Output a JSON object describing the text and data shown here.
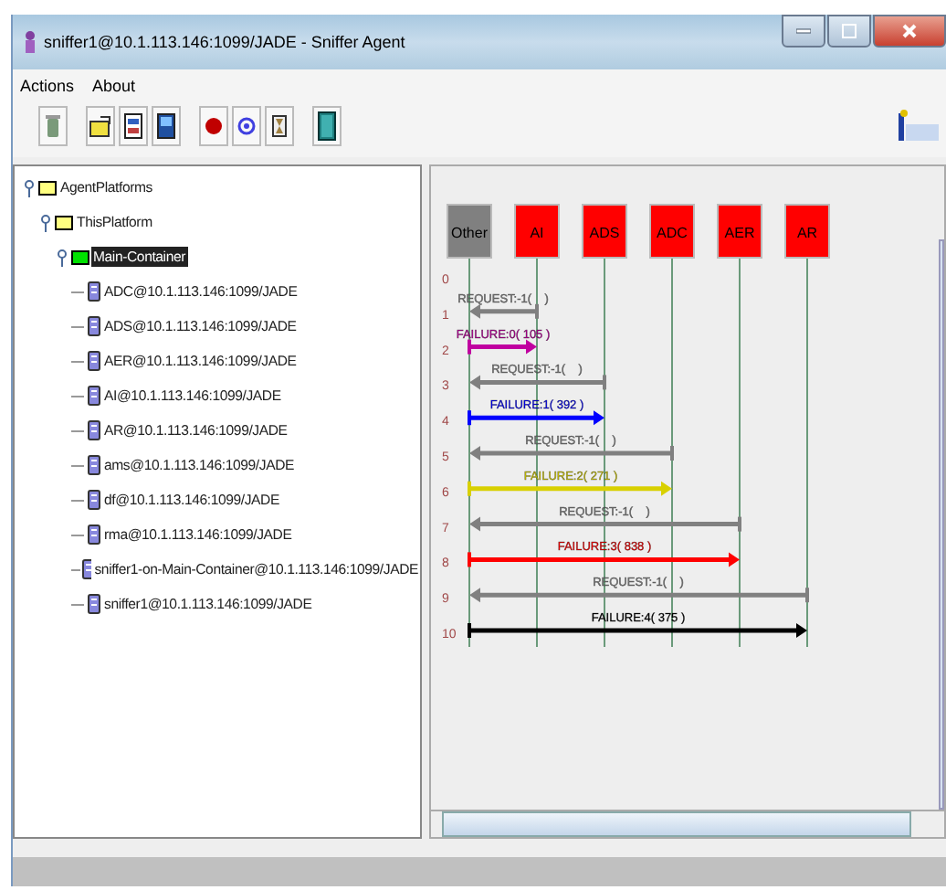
{
  "window": {
    "title": "sniffer1@10.1.113.146:1099/JADE - Sniffer Agent"
  },
  "menu": [
    {
      "label": "Actions"
    },
    {
      "label": "About"
    }
  ],
  "tree": [
    {
      "label": "AgentPlatforms",
      "kind": "folder",
      "expanded": true,
      "selected": false,
      "children": [
        {
          "label": "ThisPlatform",
          "kind": "folder",
          "expanded": true,
          "selected": false,
          "children": [
            {
              "label": "Main-Container",
              "kind": "container",
              "expanded": true,
              "selected": true,
              "children": [
                {
                  "label": "ADC@10.1.113.146:1099/JADE",
                  "kind": "agent",
                  "selected": false
                },
                {
                  "label": "ADS@10.1.113.146:1099/JADE",
                  "kind": "agent",
                  "selected": false
                },
                {
                  "label": "AER@10.1.113.146:1099/JADE",
                  "kind": "agent",
                  "selected": false
                },
                {
                  "label": "AI@10.1.113.146:1099/JADE",
                  "kind": "agent",
                  "selected": false
                },
                {
                  "label": "AR@10.1.113.146:1099/JADE",
                  "kind": "agent",
                  "selected": false
                },
                {
                  "label": "ams@10.1.113.146:1099/JADE",
                  "kind": "agent",
                  "selected": false
                },
                {
                  "label": "df@10.1.113.146:1099/JADE",
                  "kind": "agent",
                  "selected": false
                },
                {
                  "label": "rma@10.1.113.146:1099/JADE",
                  "kind": "agent",
                  "selected": false
                },
                {
                  "label": "sniffer1-on-Main-Container@10.1.113.146:1099/JADE",
                  "kind": "agent",
                  "selected": false
                },
                {
                  "label": "sniffer1@10.1.113.146:1099/JADE",
                  "kind": "agent",
                  "selected": false
                }
              ]
            }
          ]
        }
      ]
    }
  ],
  "sniffer": {
    "agents": [
      {
        "name": "Other",
        "color": "#808080"
      },
      {
        "name": "AI",
        "color": "#ff0000"
      },
      {
        "name": "ADS",
        "color": "#ff0000"
      },
      {
        "name": "ADC",
        "color": "#ff0000"
      },
      {
        "name": "AER",
        "color": "#ff0000"
      },
      {
        "name": "AR",
        "color": "#ff0000"
      }
    ],
    "rows": [
      "0",
      "1",
      "2",
      "3",
      "4",
      "5",
      "6",
      "7",
      "8",
      "9",
      "10"
    ],
    "messages": [
      {
        "kind": "incoming",
        "label": "REQUEST:-1(    )",
        "color": "#808080"
      },
      {
        "kind": "outgoing",
        "label": "FAILURE:0( 105 )",
        "color": "#c000a0"
      },
      {
        "kind": "incoming",
        "label": "REQUEST:-1(    )",
        "color": "#808080"
      },
      {
        "kind": "outgoing",
        "label": "FAILURE:1( 392 )",
        "color": "#0000ff"
      },
      {
        "kind": "incoming",
        "label": "REQUEST:-1(    )",
        "color": "#808080"
      },
      {
        "kind": "outgoing",
        "label": "FAILURE:2( 271 )",
        "color": "#d8d000"
      },
      {
        "kind": "incoming",
        "label": "REQUEST:-1(    )",
        "color": "#808080"
      },
      {
        "kind": "outgoing",
        "label": "FAILURE:3( 838 )",
        "color": "#ff0000"
      },
      {
        "kind": "incoming",
        "label": "REQUEST:-1(    )",
        "color": "#808080"
      },
      {
        "kind": "outgoing",
        "label": "FAILURE:4( 375 )",
        "color": "#000000"
      }
    ]
  }
}
